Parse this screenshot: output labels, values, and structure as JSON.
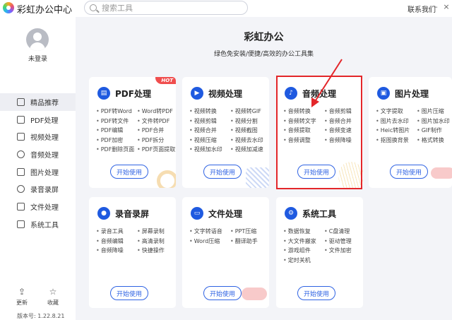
{
  "app": {
    "title": "彩虹办公中心"
  },
  "search": {
    "placeholder": "搜索工具"
  },
  "header": {
    "contact": "联系我们",
    "minimize": "–",
    "close": "×"
  },
  "sidebar": {
    "user_label": "未登录",
    "items": [
      {
        "label": "精品推荐",
        "icon": "thumbs-up-icon",
        "active": true
      },
      {
        "label": "PDF处理",
        "icon": "pdf-icon",
        "active": false
      },
      {
        "label": "视频处理",
        "icon": "video-icon",
        "active": false
      },
      {
        "label": "音频处理",
        "icon": "music-icon",
        "active": false
      },
      {
        "label": "图片处理",
        "icon": "image-icon",
        "active": false
      },
      {
        "label": "录音录屏",
        "icon": "record-icon",
        "active": false
      },
      {
        "label": "文件处理",
        "icon": "folder-icon",
        "active": false
      },
      {
        "label": "系统工具",
        "icon": "system-icon",
        "active": false
      }
    ],
    "update_label": "更新",
    "favorite_label": "收藏",
    "version": "版本号: 1.22.8.21"
  },
  "main": {
    "title": "彩虹办公",
    "subtitle": "绿色免安装/便捷/高效的办公工具集",
    "start_label": "开始使用",
    "hot_badge": "HOT",
    "cards": [
      {
        "title": "PDF处理",
        "icon": "pdf-icon",
        "hot": true,
        "features": [
          "PDF转Word",
          "Word转PDF",
          "PDF转文件",
          "文件转PDF",
          "PDF编辑",
          "PDF合并",
          "PDF加密",
          "PDF拆分",
          "PDF删除页面",
          "PDF页面提取"
        ]
      },
      {
        "title": "视频处理",
        "icon": "video-icon",
        "hot": false,
        "features": [
          "视频转换",
          "视频转GIF",
          "视频剪辑",
          "视频分割",
          "视频合并",
          "视频截图",
          "视频压缩",
          "视频去水印",
          "视频加水印",
          "视频加减速"
        ]
      },
      {
        "title": "音频处理",
        "icon": "music-icon",
        "hot": false,
        "features": [
          "音频转换",
          "音频剪辑",
          "音频转文字",
          "音频合并",
          "音频提取",
          "音频变速",
          "音频调整",
          "音频降噪"
        ]
      },
      {
        "title": "图片处理",
        "icon": "image-icon",
        "hot": false,
        "features": [
          "文字提取",
          "图片压缩",
          "图片去水印",
          "图片加水印",
          "Heic转图片",
          "GIF制作",
          "抠图换背景",
          "格式转换"
        ]
      },
      {
        "title": "录音录屏",
        "icon": "microphone-icon",
        "hot": false,
        "features": [
          "录音工具",
          "屏幕录制",
          "音频编辑",
          "高清录制",
          "音频降噪",
          "快捷操作"
        ]
      },
      {
        "title": "文件处理",
        "icon": "folder-icon",
        "hot": false,
        "features": [
          "文字转语音",
          "PPT压缩",
          "Word压缩",
          "翻译助手"
        ]
      },
      {
        "title": "系统工具",
        "icon": "gear-icon",
        "hot": false,
        "features": [
          "数据恢复",
          "C盘清理",
          "大文件搬家",
          "驱动管理",
          "游戏组件",
          "文件加密",
          "定时关机"
        ]
      }
    ]
  },
  "colors": {
    "accent": "#2f63e3",
    "highlight": "#e3262a",
    "hot": "#f04e4e",
    "icon_bg": "#1f5ae0"
  }
}
